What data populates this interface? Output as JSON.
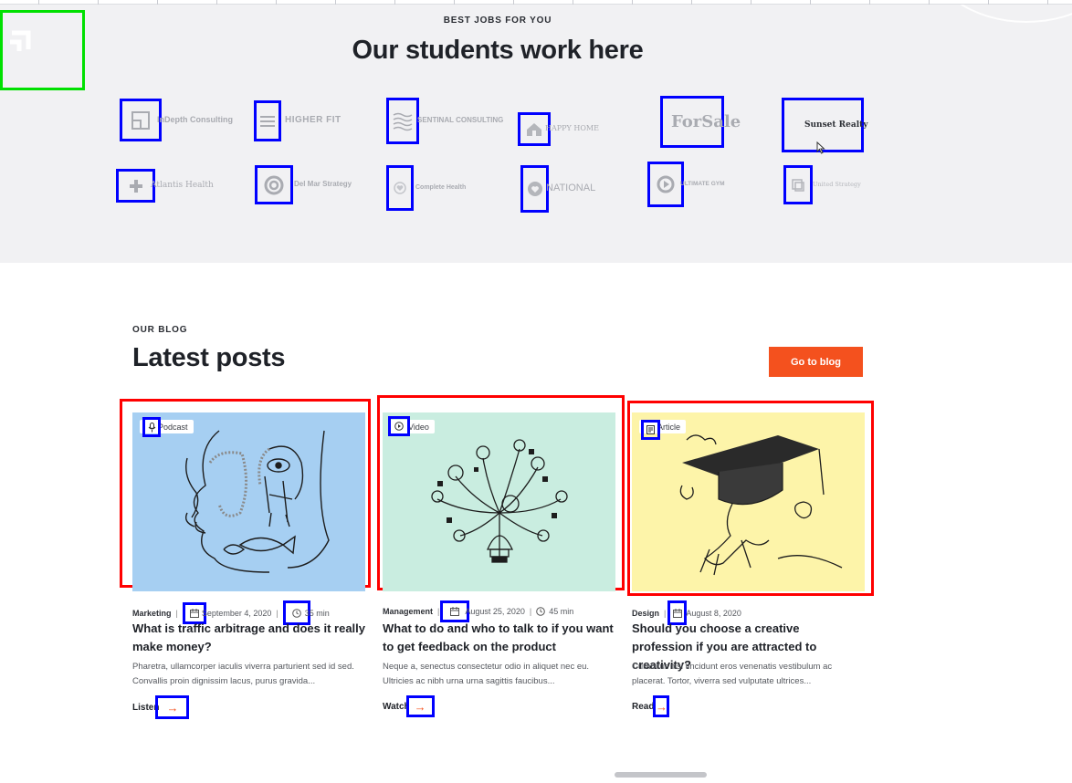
{
  "partners": {
    "eyebrow": "BEST JOBS FOR YOU",
    "title": "Our students work here",
    "logos_row1": [
      {
        "name": "InDepth Consulting",
        "icon": "window-square-icon"
      },
      {
        "name": "HIGHER FIT",
        "icon": "stripes-icon"
      },
      {
        "name": "SENTINAL CONSULTING",
        "icon": "waves-icon"
      },
      {
        "name": "HAPPY HOME",
        "icon": "house-icon"
      },
      {
        "name": "ForSale",
        "icon": "sign-post-icon"
      },
      {
        "name": "Sunset Realty",
        "icon": "house-sun-icon"
      }
    ],
    "logos_row2": [
      {
        "name": "Atlantis Health",
        "icon": "cross-icon"
      },
      {
        "name": "Del Mar Strategy",
        "icon": "swirl-icon"
      },
      {
        "name": "Complete Health",
        "icon": "heart-circle-icon"
      },
      {
        "name": "NATIONAL",
        "icon": "circle-badge-icon"
      },
      {
        "name": "ULTIMATE GYM",
        "icon": "play-circle-icon"
      },
      {
        "name": "United Strategy",
        "icon": "layers-icon"
      }
    ]
  },
  "blog": {
    "eyebrow": "OUR BLOG",
    "title": "Latest posts",
    "button": "Go to blog",
    "posts": [
      {
        "tag": "Podcast",
        "tag_icon": "microphone-icon",
        "category": "Marketing",
        "date": "September 4, 2020",
        "duration": "35 min",
        "headline": "What is traffic arbitrage and does it really make money?",
        "excerpt": "Pharetra, ullamcorper iaculis viverra parturient sed id sed. Convallis proin dignissim lacus, purus gravida...",
        "cta": "Listen",
        "bg": "#a6cff2"
      },
      {
        "tag": "Video",
        "tag_icon": "play-icon",
        "category": "Management",
        "date": "August 25, 2020",
        "duration": "45 min",
        "headline": "What to do and who to talk to if you want to get feedback on the product",
        "excerpt": "Neque a, senectus consectetur odio in aliquet nec eu. Ultricies ac nibh urna urna sagittis faucibus...",
        "cta": "Watch",
        "bg": "#c9ede0"
      },
      {
        "tag": "Article",
        "tag_icon": "document-icon",
        "category": "Design",
        "date": "August 8, 2020",
        "duration": "",
        "headline": "Should you choose a creative profession if you are attracted to creativity?",
        "excerpt": "Curabitur nisl tincidunt eros venenatis vestibulum ac placerat. Tortor, viverra sed vulputate ultrices...",
        "cta": "Read",
        "bg": "#fdf4a9"
      }
    ]
  },
  "colors": {
    "accent": "#f4511e",
    "section_bg": "#f1f1f3",
    "highlight_blue": "#0000ff",
    "highlight_red": "#ff0000",
    "highlight_green": "#00e000"
  }
}
